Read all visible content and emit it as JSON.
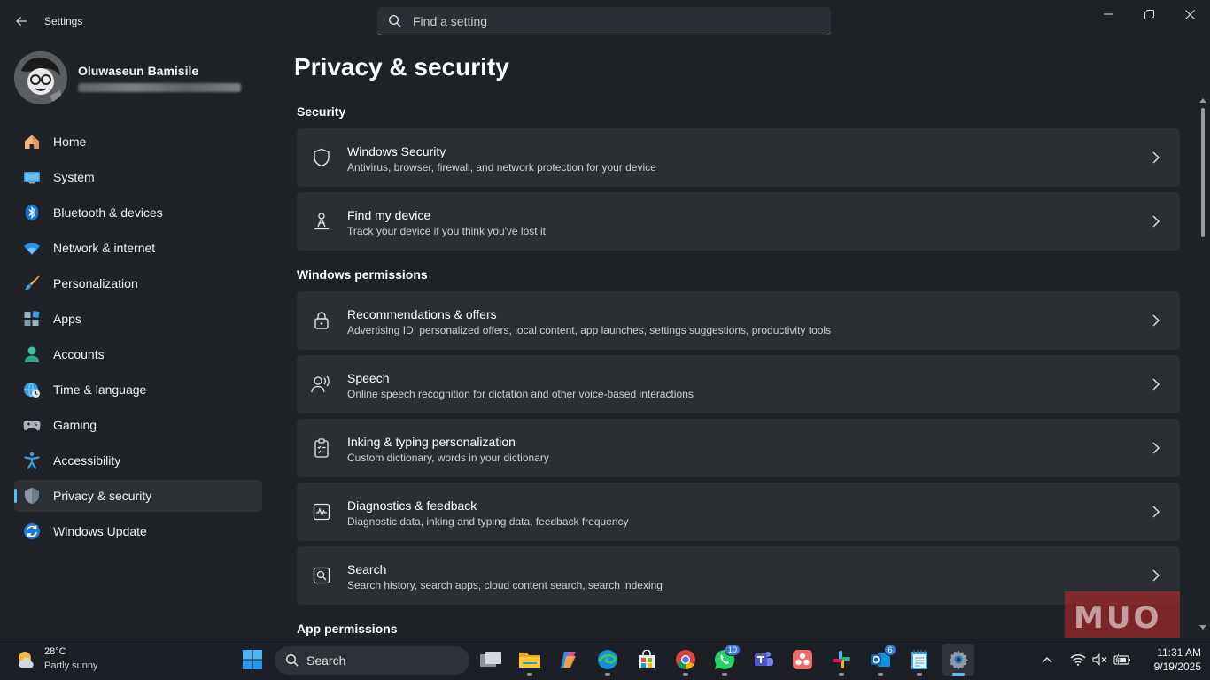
{
  "window": {
    "app_title": "Settings",
    "search_placeholder": "Find a setting"
  },
  "profile": {
    "name": "Oluwaseun Bamisile"
  },
  "sidebar": {
    "items": [
      {
        "label": "Home",
        "icon": "home-icon"
      },
      {
        "label": "System",
        "icon": "system-icon"
      },
      {
        "label": "Bluetooth & devices",
        "icon": "bluetooth-icon"
      },
      {
        "label": "Network & internet",
        "icon": "wifi-icon"
      },
      {
        "label": "Personalization",
        "icon": "brush-icon"
      },
      {
        "label": "Apps",
        "icon": "apps-icon"
      },
      {
        "label": "Accounts",
        "icon": "accounts-icon"
      },
      {
        "label": "Time & language",
        "icon": "globe-clock-icon"
      },
      {
        "label": "Gaming",
        "icon": "gamepad-icon"
      },
      {
        "label": "Accessibility",
        "icon": "accessibility-icon"
      },
      {
        "label": "Privacy & security",
        "icon": "shield-icon",
        "active": true
      },
      {
        "label": "Windows Update",
        "icon": "update-icon"
      }
    ]
  },
  "main": {
    "title": "Privacy & security",
    "sections": [
      {
        "heading": "Security",
        "items": [
          {
            "title": "Windows Security",
            "subtitle": "Antivirus, browser, firewall, and network protection for your device",
            "icon": "shield-outline-icon"
          },
          {
            "title": "Find my device",
            "subtitle": "Track your device if you think you've lost it",
            "icon": "locate-person-icon"
          }
        ]
      },
      {
        "heading": "Windows permissions",
        "items": [
          {
            "title": "Recommendations & offers",
            "subtitle": "Advertising ID, personalized offers, local content, app launches, settings suggestions, productivity tools",
            "icon": "lock-icon"
          },
          {
            "title": "Speech",
            "subtitle": "Online speech recognition for dictation and other voice-based interactions",
            "icon": "speech-icon"
          },
          {
            "title": "Inking & typing personalization",
            "subtitle": "Custom dictionary, words in your dictionary",
            "icon": "clipboard-list-icon"
          },
          {
            "title": "Diagnostics & feedback",
            "subtitle": "Diagnostic data, inking and typing data, feedback frequency",
            "icon": "pulse-icon"
          },
          {
            "title": "Search",
            "subtitle": "Search history, search apps, cloud content search, search indexing",
            "icon": "search-box-icon"
          }
        ]
      },
      {
        "heading": "App permissions",
        "items": []
      }
    ]
  },
  "watermark": "MUO",
  "taskbar": {
    "weather": {
      "temp": "28°C",
      "condition": "Partly sunny"
    },
    "search_label": "Search",
    "apps": [
      {
        "name": "start-button",
        "icon": "windows-logo-icon"
      },
      {
        "name": "task-view",
        "icon": "task-view-icon"
      },
      {
        "name": "file-explorer",
        "icon": "folder-icon"
      },
      {
        "name": "copilot",
        "icon": "copilot-icon"
      },
      {
        "name": "edge",
        "icon": "edge-icon"
      },
      {
        "name": "microsoft-store",
        "icon": "store-icon"
      },
      {
        "name": "chrome",
        "icon": "chrome-icon"
      },
      {
        "name": "whatsapp",
        "icon": "whatsapp-icon",
        "badge": "10"
      },
      {
        "name": "teams",
        "icon": "teams-icon"
      },
      {
        "name": "asana",
        "icon": "asana-icon"
      },
      {
        "name": "slack",
        "icon": "slack-icon"
      },
      {
        "name": "outlook",
        "icon": "outlook-icon",
        "badge": "6"
      },
      {
        "name": "notepad",
        "icon": "notepad-icon"
      },
      {
        "name": "settings",
        "icon": "settings-gear-icon",
        "active": true
      }
    ],
    "clock": {
      "time": "11:31 AM",
      "date": "9/19/2025"
    }
  },
  "colors": {
    "accent": "#4cc2ff",
    "background": "#1f2328",
    "card": "#2b2e33"
  }
}
